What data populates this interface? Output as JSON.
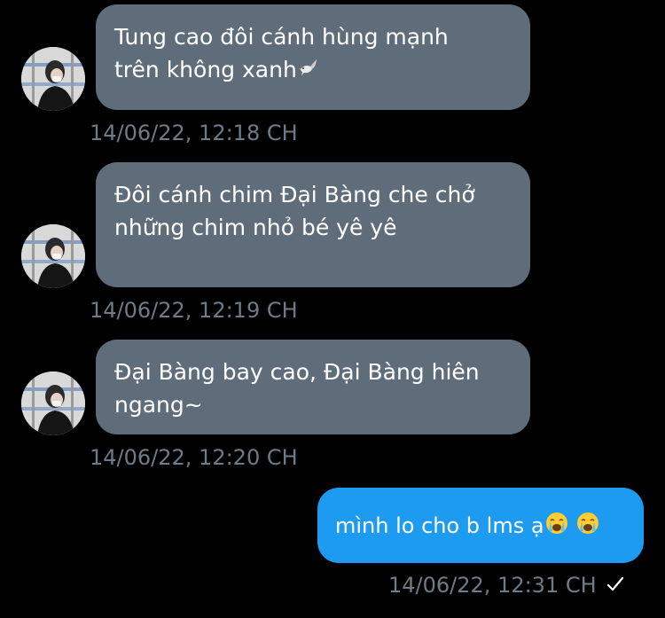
{
  "messages": [
    {
      "direction": "incoming",
      "lines": [
        "Tung cao đôi cánh hùng mạnh",
        "trên không xanh"
      ],
      "trailing_icon": "dove-emoji-icon",
      "timestamp": "14/06/22, 12:18 CH"
    },
    {
      "direction": "incoming",
      "lines": [
        "Đôi cánh chim Đại Bàng che chở",
        "những chim nhỏ bé yê yê"
      ],
      "timestamp": "14/06/22, 12:19 CH"
    },
    {
      "direction": "incoming",
      "lines": [
        "Đại Bàng bay cao, Đại Bàng hiên",
        "ngang~"
      ],
      "timestamp": "14/06/22, 12:20 CH"
    },
    {
      "direction": "outgoing",
      "text": "mình lo cho b lms ạ",
      "trailing_icons": [
        "loudly-crying-face-emoji-icon",
        "loudly-crying-face-emoji-icon"
      ],
      "timestamp": "14/06/22, 12:31 CH",
      "status_icon": "checkmark-icon"
    }
  ],
  "colors": {
    "background": "#000000",
    "incoming_bubble": "#5f6d7b",
    "outgoing_bubble": "#1d9bf0",
    "timestamp": "#6f7b87",
    "text": "#ffffff"
  }
}
